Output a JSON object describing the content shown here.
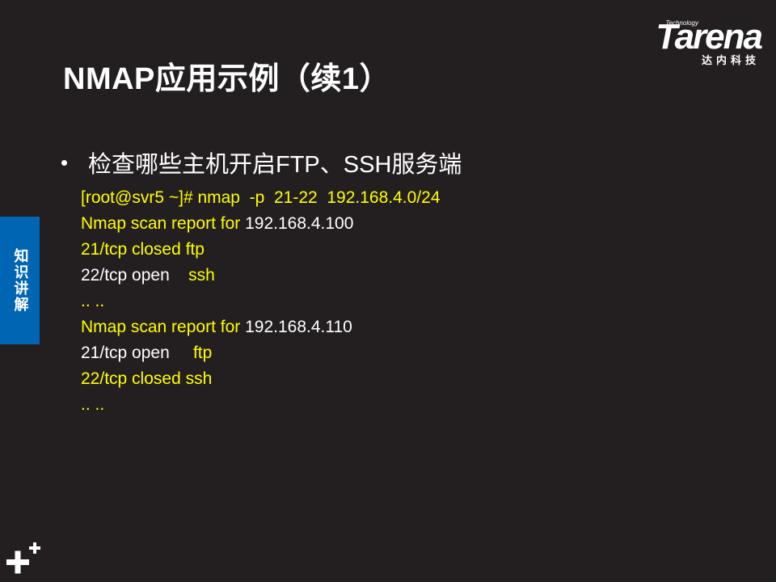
{
  "slide": {
    "title": "NMAP应用示例（续1）",
    "logo": {
      "wordmark": "Tarena",
      "small": "Technology",
      "subtitle": "达内科技"
    },
    "side_tab": "知识讲解",
    "bullet": "检查哪些主机开启FTP、SSH服务端",
    "code_lines": [
      [
        {
          "t": "[root@svr5 ~]# nmap  -p  21-22  192.168.4.0/24",
          "c": "y"
        }
      ],
      [
        {
          "t": "Nmap scan report for ",
          "c": "y"
        },
        {
          "t": "192.168.4.100",
          "c": "w"
        }
      ],
      [
        {
          "t": "21/tcp closed ftp",
          "c": "y"
        }
      ],
      [
        {
          "t": "22/tcp ",
          "c": "w"
        },
        {
          "t": "open",
          "c": "w"
        },
        {
          "t": "    ssh",
          "c": "y"
        }
      ],
      [
        {
          "t": ".. ..",
          "c": "y"
        }
      ],
      [
        {
          "t": "Nmap scan report for ",
          "c": "y"
        },
        {
          "t": "192.168.4.110",
          "c": "w"
        }
      ],
      [
        {
          "t": "21/tcp ",
          "c": "w"
        },
        {
          "t": "open",
          "c": "w"
        },
        {
          "t": "     ftp",
          "c": "y"
        }
      ],
      [
        {
          "t": "22/tcp closed ssh",
          "c": "y"
        }
      ],
      [
        {
          "t": ".. ..",
          "c": "y"
        }
      ]
    ],
    "colors": {
      "background": "#231f20",
      "code_highlight": "#ffff00",
      "tab_blue": "#0065b3"
    }
  }
}
